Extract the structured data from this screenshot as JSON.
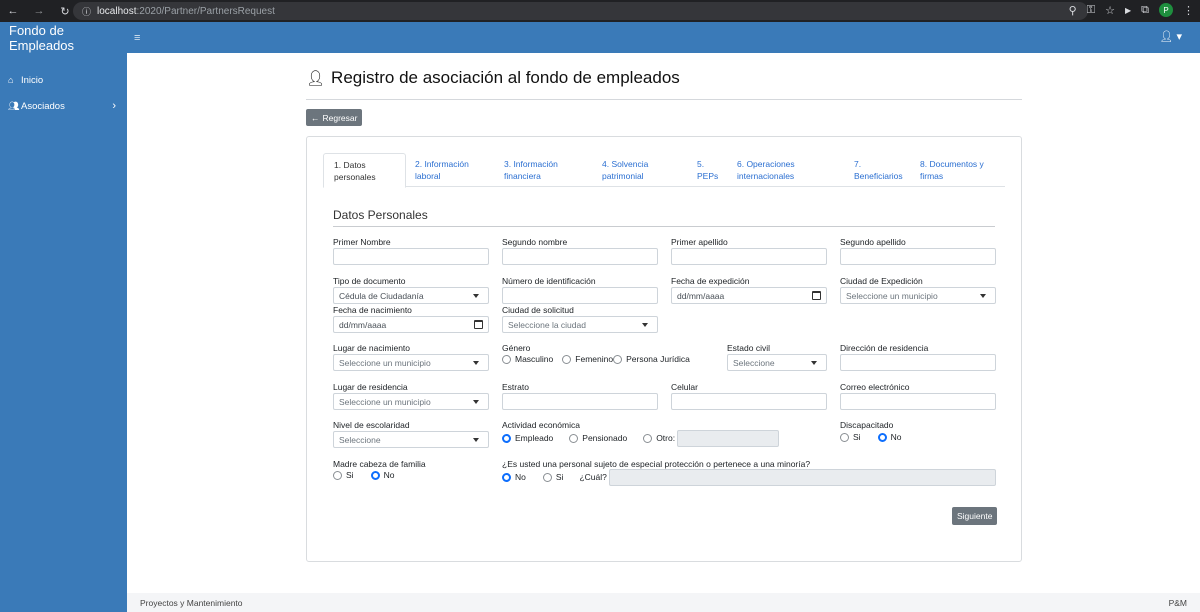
{
  "browser": {
    "url_host": "localhost",
    "url_path": ":2020/Partner/PartnersRequest",
    "profile_initial": "P"
  },
  "app": {
    "brand": "Fondo de Empleados",
    "accent": "#3a7ab8"
  },
  "sidebar": {
    "items": [
      {
        "label": "Inicio",
        "icon": "home-icon"
      },
      {
        "label": "Asociados",
        "icon": "users-icon"
      }
    ]
  },
  "page": {
    "title": "Registro de asociación al fondo de empleados",
    "back_label": "Regresar",
    "next_label": "Siguiente"
  },
  "tabs": [
    {
      "line1": "1. Datos",
      "line2": "personales",
      "active": true
    },
    {
      "line1": "2. Información",
      "line2": "laboral"
    },
    {
      "line1": "3. Información",
      "line2": "financiera"
    },
    {
      "line1": "4. Solvencia",
      "line2": "patrimonial"
    },
    {
      "line1": "5.",
      "line2": "PEPs"
    },
    {
      "line1": "6. Operaciones",
      "line2": "internacionales"
    },
    {
      "line1": "7.",
      "line2": "Beneficiarios"
    },
    {
      "line1": "8. Documentos y",
      "line2": "firmas"
    }
  ],
  "form": {
    "section_title": "Datos Personales",
    "primer_nombre": {
      "label": "Primer Nombre",
      "value": ""
    },
    "segundo_nombre": {
      "label": "Segundo nombre",
      "value": ""
    },
    "primer_apellido": {
      "label": "Primer apellido",
      "value": ""
    },
    "segundo_apellido": {
      "label": "Segundo apellido",
      "value": ""
    },
    "tipo_documento": {
      "label": "Tipo de documento",
      "value": "Cédula de Ciudadanía"
    },
    "numero_identificacion": {
      "label": "Número de identificación",
      "value": ""
    },
    "fecha_expedicion": {
      "label": "Fecha de expedición",
      "value": "dd/mm/aaaa"
    },
    "ciudad_expedicion": {
      "label": "Ciudad de Expedición",
      "placeholder": "Seleccione un municipio"
    },
    "fecha_nacimiento": {
      "label": "Fecha de nacimiento",
      "value": "dd/mm/aaaa"
    },
    "ciudad_solicitud": {
      "label": "Ciudad de solicitud",
      "placeholder": "Seleccione  la ciudad"
    },
    "lugar_nacimiento": {
      "label": "Lugar de nacimiento",
      "placeholder": "Seleccione un municipio"
    },
    "genero": {
      "label": "Género",
      "options": [
        "Masculino",
        "Femenino",
        "Persona Jurídica"
      ]
    },
    "estado_civil": {
      "label": "Estado civil",
      "placeholder": "Seleccione"
    },
    "direccion_residencia": {
      "label": "Dirección de residencia",
      "value": ""
    },
    "lugar_residencia": {
      "label": "Lugar de residencia",
      "placeholder": "Seleccione un municipio"
    },
    "estrato": {
      "label": "Estrato",
      "value": ""
    },
    "celular": {
      "label": "Celular",
      "value": ""
    },
    "correo": {
      "label": "Correo electrónico",
      "value": ""
    },
    "nivel_escolaridad": {
      "label": "Nivel de escolaridad",
      "placeholder": "Seleccione"
    },
    "actividad_economica": {
      "label": "Actividad económica",
      "options": [
        "Empleado",
        "Pensionado",
        "Otro:"
      ],
      "selected": "Empleado"
    },
    "discapacitado": {
      "label": "Discapacitado",
      "options": [
        "Si",
        "No"
      ],
      "selected": "No"
    },
    "madre_cabeza": {
      "label": "Madre cabeza de familia",
      "options": [
        "Si",
        "No"
      ],
      "selected": "No"
    },
    "proteccion": {
      "label": "¿Es usted una personal sujeto de especial protección o pertenece a una minoría?",
      "options": [
        "No",
        "Si"
      ],
      "selected": "No",
      "cual_label": "¿Cuál?"
    }
  },
  "footer": {
    "left": "Proyectos y Mantenimiento",
    "right": "P&M"
  }
}
